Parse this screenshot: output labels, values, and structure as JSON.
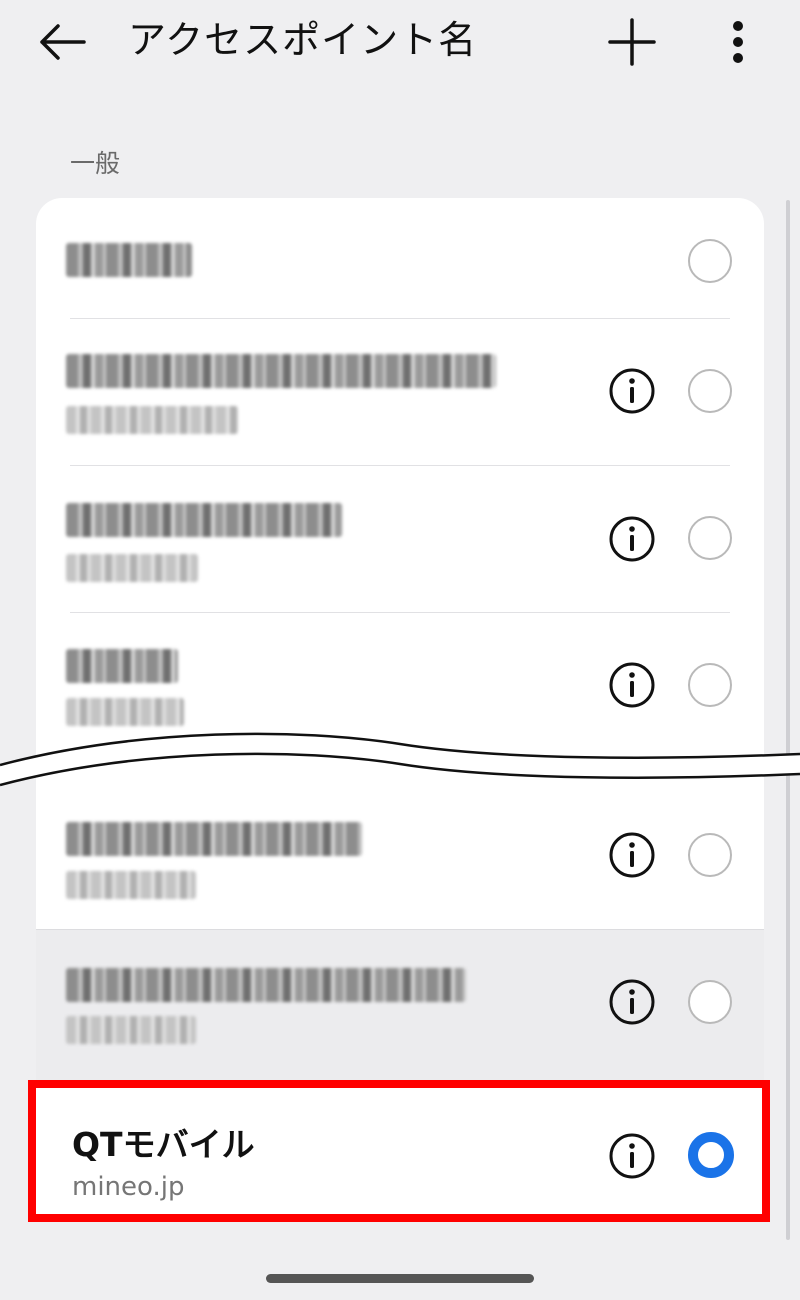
{
  "header": {
    "title": "アクセスポイント名",
    "back_icon": "arrow-left-icon",
    "add_icon": "plus-icon",
    "more_icon": "more-vertical-icon"
  },
  "section": {
    "label": "一般"
  },
  "apn_list": {
    "selected": {
      "name": "QTモバイル",
      "apn": "mineo.jp"
    }
  },
  "colors": {
    "accent": "#1a73e8",
    "highlight_border": "#ff0000",
    "background": "#efeff1"
  }
}
